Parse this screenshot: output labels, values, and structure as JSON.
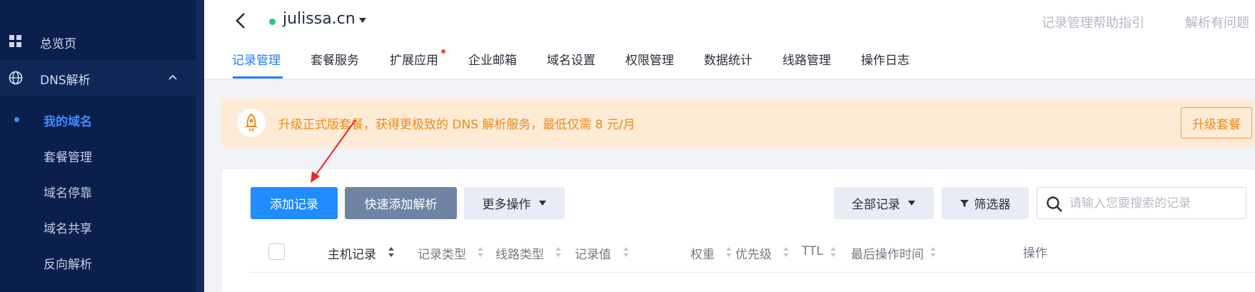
{
  "sidebar": {
    "overview_label": "总览页",
    "dns_label": "DNS解析",
    "sub_items": [
      "我的域名",
      "套餐管理",
      "域名停靠",
      "域名共享",
      "反向解析"
    ]
  },
  "header": {
    "domain": "julissa.cn",
    "help_links": [
      "记录管理帮助指引",
      "解析有问题"
    ],
    "tabs": [
      "记录管理",
      "套餐服务",
      "扩展应用",
      "企业邮箱",
      "域名设置",
      "权限管理",
      "数据统计",
      "线路管理",
      "操作日志"
    ]
  },
  "banner": {
    "text": "升级正式版套餐，获得更极致的 DNS 解析服务，最低仅需 8 元/月",
    "button": "升级套餐"
  },
  "toolbar": {
    "add_record": "添加记录",
    "quick_add": "快速添加解析",
    "more_ops": "更多操作",
    "all_records": "全部记录",
    "filter": "筛选器",
    "search_placeholder": "请输入您要搜索的记录"
  },
  "table": {
    "columns": [
      "主机记录",
      "记录类型",
      "线路类型",
      "记录值",
      "权重",
      "优先级",
      "TTL",
      "最后操作时间",
      "操作"
    ]
  },
  "colors": {
    "sidebar_bg": "#0b1f4d",
    "accent": "#1f8cff",
    "banner_bg": "#fdebd6",
    "banner_text": "#f08a17",
    "status_online": "#2ec27e",
    "annotation_arrow": "#e8262b"
  }
}
